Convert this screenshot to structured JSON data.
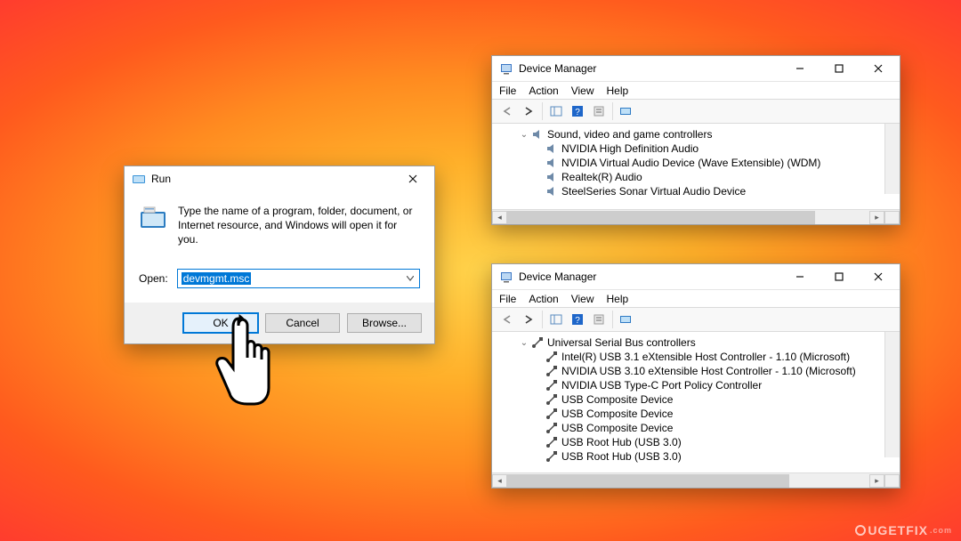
{
  "run": {
    "title": "Run",
    "description": "Type the name of a program, folder, document, or Internet resource, and Windows will open it for you.",
    "open_label": "Open:",
    "input_value": "devmgmt.msc",
    "buttons": {
      "ok": "OK",
      "cancel": "Cancel",
      "browse": "Browse..."
    }
  },
  "dm1": {
    "title": "Device Manager",
    "menus": {
      "file": "File",
      "action": "Action",
      "view": "View",
      "help": "Help"
    },
    "category": "Sound, video and game controllers",
    "items": [
      "NVIDIA High Definition Audio",
      "NVIDIA Virtual Audio Device (Wave Extensible) (WDM)",
      "Realtek(R) Audio",
      "SteelSeries Sonar Virtual Audio Device"
    ]
  },
  "dm2": {
    "title": "Device Manager",
    "menus": {
      "file": "File",
      "action": "Action",
      "view": "View",
      "help": "Help"
    },
    "category": "Universal Serial Bus controllers",
    "items": [
      "Intel(R) USB 3.1 eXtensible Host Controller - 1.10 (Microsoft)",
      "NVIDIA USB 3.10 eXtensible Host Controller - 1.10 (Microsoft)",
      "NVIDIA USB Type-C Port Policy Controller",
      "USB Composite Device",
      "USB Composite Device",
      "USB Composite Device",
      "USB Root Hub (USB 3.0)",
      "USB Root Hub (USB 3.0)"
    ]
  },
  "watermark": "UGETFIX"
}
